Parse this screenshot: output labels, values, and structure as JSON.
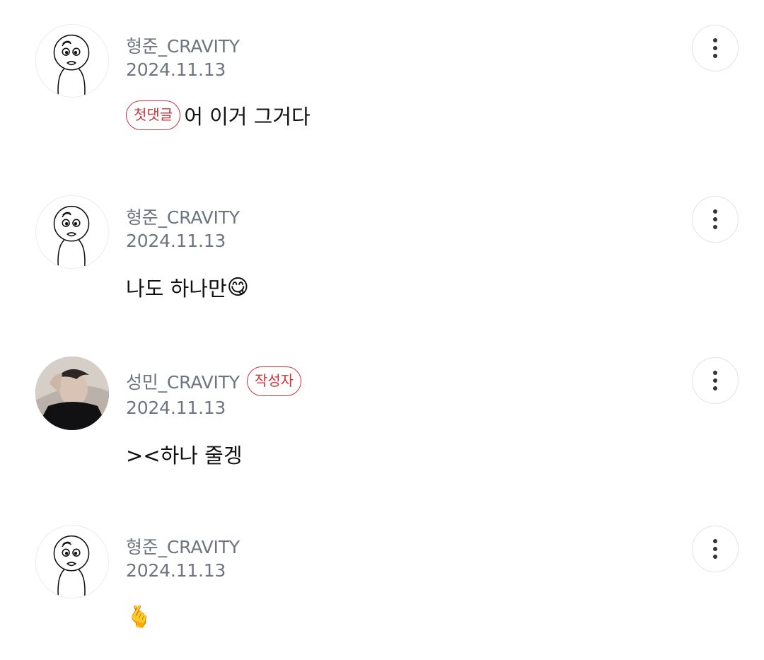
{
  "comments": [
    {
      "author": "형준_CRAVITY",
      "date": "2024.11.13",
      "badge": "첫댓글",
      "text": "어 이거 그거다",
      "emoji": ""
    },
    {
      "author": "형준_CRAVITY",
      "date": "2024.11.13",
      "text": "나도 하나만",
      "emoji": "😋"
    },
    {
      "author": "성민_CRAVITY",
      "author_badge": "작성자",
      "date": "2024.11.13",
      "text": "><하나 줄겡",
      "emoji": ""
    },
    {
      "author": "형준_CRAVITY",
      "date": "2024.11.13",
      "text": "",
      "emoji": "🫰"
    }
  ],
  "colors": {
    "badge_red": "#c9363b",
    "meta_gray": "#6e7480",
    "text": "#111111"
  },
  "icons": {
    "more": "more-vertical-icon"
  }
}
